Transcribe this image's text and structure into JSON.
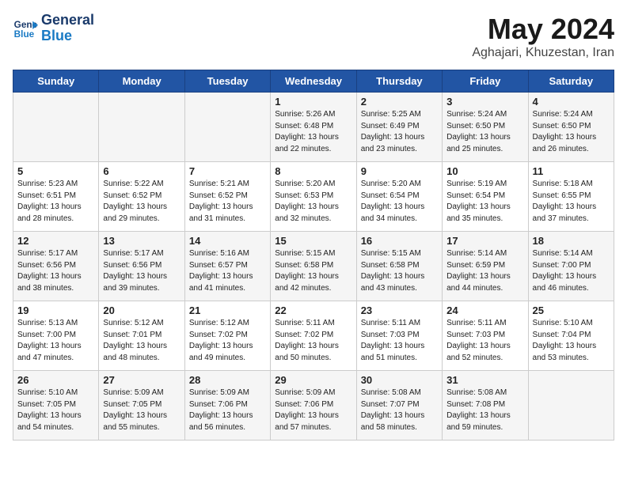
{
  "header": {
    "logo_line1": "General",
    "logo_line2": "Blue",
    "title": "May 2024",
    "subtitle": "Aghajari, Khuzestan, Iran"
  },
  "days_of_week": [
    "Sunday",
    "Monday",
    "Tuesday",
    "Wednesday",
    "Thursday",
    "Friday",
    "Saturday"
  ],
  "weeks": [
    [
      {
        "day": "",
        "info": ""
      },
      {
        "day": "",
        "info": ""
      },
      {
        "day": "",
        "info": ""
      },
      {
        "day": "1",
        "info": "Sunrise: 5:26 AM\nSunset: 6:48 PM\nDaylight: 13 hours\nand 22 minutes."
      },
      {
        "day": "2",
        "info": "Sunrise: 5:25 AM\nSunset: 6:49 PM\nDaylight: 13 hours\nand 23 minutes."
      },
      {
        "day": "3",
        "info": "Sunrise: 5:24 AM\nSunset: 6:50 PM\nDaylight: 13 hours\nand 25 minutes."
      },
      {
        "day": "4",
        "info": "Sunrise: 5:24 AM\nSunset: 6:50 PM\nDaylight: 13 hours\nand 26 minutes."
      }
    ],
    [
      {
        "day": "5",
        "info": "Sunrise: 5:23 AM\nSunset: 6:51 PM\nDaylight: 13 hours\nand 28 minutes."
      },
      {
        "day": "6",
        "info": "Sunrise: 5:22 AM\nSunset: 6:52 PM\nDaylight: 13 hours\nand 29 minutes."
      },
      {
        "day": "7",
        "info": "Sunrise: 5:21 AM\nSunset: 6:52 PM\nDaylight: 13 hours\nand 31 minutes."
      },
      {
        "day": "8",
        "info": "Sunrise: 5:20 AM\nSunset: 6:53 PM\nDaylight: 13 hours\nand 32 minutes."
      },
      {
        "day": "9",
        "info": "Sunrise: 5:20 AM\nSunset: 6:54 PM\nDaylight: 13 hours\nand 34 minutes."
      },
      {
        "day": "10",
        "info": "Sunrise: 5:19 AM\nSunset: 6:54 PM\nDaylight: 13 hours\nand 35 minutes."
      },
      {
        "day": "11",
        "info": "Sunrise: 5:18 AM\nSunset: 6:55 PM\nDaylight: 13 hours\nand 37 minutes."
      }
    ],
    [
      {
        "day": "12",
        "info": "Sunrise: 5:17 AM\nSunset: 6:56 PM\nDaylight: 13 hours\nand 38 minutes."
      },
      {
        "day": "13",
        "info": "Sunrise: 5:17 AM\nSunset: 6:56 PM\nDaylight: 13 hours\nand 39 minutes."
      },
      {
        "day": "14",
        "info": "Sunrise: 5:16 AM\nSunset: 6:57 PM\nDaylight: 13 hours\nand 41 minutes."
      },
      {
        "day": "15",
        "info": "Sunrise: 5:15 AM\nSunset: 6:58 PM\nDaylight: 13 hours\nand 42 minutes."
      },
      {
        "day": "16",
        "info": "Sunrise: 5:15 AM\nSunset: 6:58 PM\nDaylight: 13 hours\nand 43 minutes."
      },
      {
        "day": "17",
        "info": "Sunrise: 5:14 AM\nSunset: 6:59 PM\nDaylight: 13 hours\nand 44 minutes."
      },
      {
        "day": "18",
        "info": "Sunrise: 5:14 AM\nSunset: 7:00 PM\nDaylight: 13 hours\nand 46 minutes."
      }
    ],
    [
      {
        "day": "19",
        "info": "Sunrise: 5:13 AM\nSunset: 7:00 PM\nDaylight: 13 hours\nand 47 minutes."
      },
      {
        "day": "20",
        "info": "Sunrise: 5:12 AM\nSunset: 7:01 PM\nDaylight: 13 hours\nand 48 minutes."
      },
      {
        "day": "21",
        "info": "Sunrise: 5:12 AM\nSunset: 7:02 PM\nDaylight: 13 hours\nand 49 minutes."
      },
      {
        "day": "22",
        "info": "Sunrise: 5:11 AM\nSunset: 7:02 PM\nDaylight: 13 hours\nand 50 minutes."
      },
      {
        "day": "23",
        "info": "Sunrise: 5:11 AM\nSunset: 7:03 PM\nDaylight: 13 hours\nand 51 minutes."
      },
      {
        "day": "24",
        "info": "Sunrise: 5:11 AM\nSunset: 7:03 PM\nDaylight: 13 hours\nand 52 minutes."
      },
      {
        "day": "25",
        "info": "Sunrise: 5:10 AM\nSunset: 7:04 PM\nDaylight: 13 hours\nand 53 minutes."
      }
    ],
    [
      {
        "day": "26",
        "info": "Sunrise: 5:10 AM\nSunset: 7:05 PM\nDaylight: 13 hours\nand 54 minutes."
      },
      {
        "day": "27",
        "info": "Sunrise: 5:09 AM\nSunset: 7:05 PM\nDaylight: 13 hours\nand 55 minutes."
      },
      {
        "day": "28",
        "info": "Sunrise: 5:09 AM\nSunset: 7:06 PM\nDaylight: 13 hours\nand 56 minutes."
      },
      {
        "day": "29",
        "info": "Sunrise: 5:09 AM\nSunset: 7:06 PM\nDaylight: 13 hours\nand 57 minutes."
      },
      {
        "day": "30",
        "info": "Sunrise: 5:08 AM\nSunset: 7:07 PM\nDaylight: 13 hours\nand 58 minutes."
      },
      {
        "day": "31",
        "info": "Sunrise: 5:08 AM\nSunset: 7:08 PM\nDaylight: 13 hours\nand 59 minutes."
      },
      {
        "day": "",
        "info": ""
      }
    ]
  ]
}
